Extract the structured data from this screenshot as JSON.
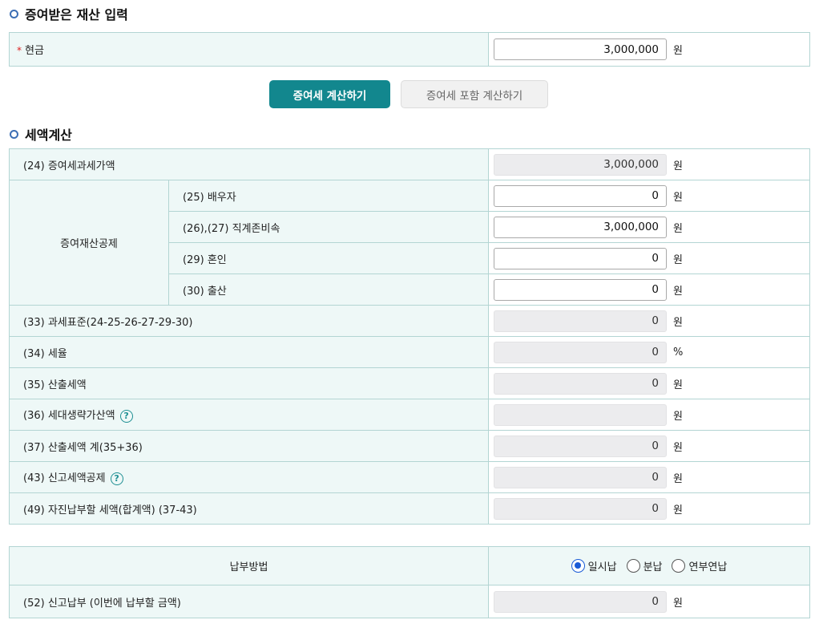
{
  "input_section": {
    "title": "증여받은 재산 입력",
    "required_mark": "*",
    "cash_label": "현금",
    "cash_value": "3,000,000",
    "unit_won": "원"
  },
  "buttons": {
    "calc": "증여세 계산하기",
    "calc_incl": "증여세 포함 계산하기"
  },
  "calc_section": {
    "title": "세액계산",
    "unit_won": "원",
    "unit_pct": "%",
    "help_glyph": "?",
    "row24": {
      "label": "(24) 증여세과세가액",
      "value": "3,000,000"
    },
    "deduction_group": "증여재산공제",
    "row25": {
      "label": "(25) 배우자",
      "value": "0"
    },
    "row2627": {
      "label": "(26),(27) 직계존비속",
      "value": "3,000,000"
    },
    "row29": {
      "label": "(29) 혼인",
      "value": "0"
    },
    "row30": {
      "label": "(30) 출산",
      "value": "0"
    },
    "row33": {
      "label": "(33) 과세표준(24-25-26-27-29-30)",
      "value": "0"
    },
    "row34": {
      "label": "(34) 세율",
      "value": "0"
    },
    "row35": {
      "label": "(35) 산출세액",
      "value": "0"
    },
    "row36": {
      "label": "(36) 세대생략가산액",
      "value": ""
    },
    "row37": {
      "label": "(37) 산출세액 계(35+36)",
      "value": "0"
    },
    "row43": {
      "label": "(43) 신고세액공제",
      "value": "0"
    },
    "row49": {
      "label": "(49) 자진납부할 세액(합계액) (37-43)",
      "value": "0"
    }
  },
  "payment_section": {
    "method_label": "납부방법",
    "options": [
      "일시납",
      "분납",
      "연부연납"
    ],
    "selected": "일시납",
    "row52": {
      "label": "(52) 신고납부 (이번에 납부할 금액)",
      "value": "0"
    }
  },
  "colors": {
    "accent": "#12878e",
    "header_bg": "#eef8f7",
    "border": "#b3d5d3",
    "radio": "#1a5bd6"
  }
}
